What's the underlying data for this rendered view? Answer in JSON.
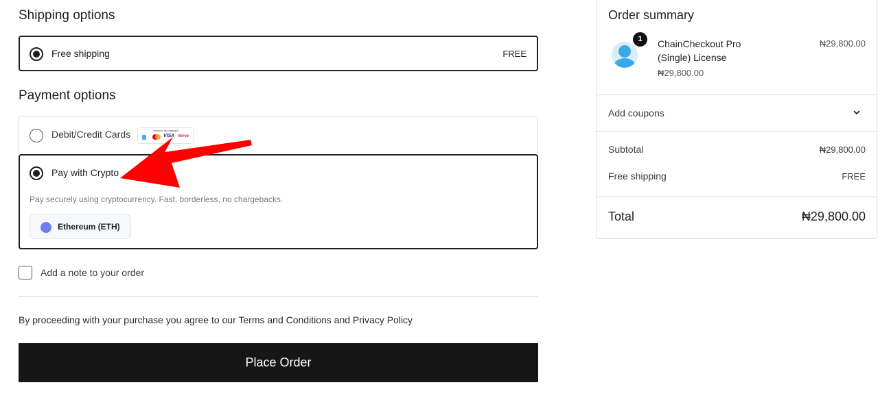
{
  "shipping": {
    "title": "Shipping options",
    "option_label": "Free shipping",
    "option_price": "FREE"
  },
  "payment": {
    "title": "Payment options",
    "card_label": "Debit/Credit Cards",
    "card_logos_caption": "Secured by paystack",
    "card_logo_visa": "VISA",
    "card_logo_verve": "Verve",
    "crypto_label": "Pay with Crypto",
    "crypto_description": "Pay securely using cryptocurrency. Fast, borderless, no chargebacks.",
    "crypto_coin": "Ethereum (ETH)"
  },
  "order_note": {
    "label": "Add a note to your order"
  },
  "terms": {
    "text": "By proceeding with your purchase you agree to our Terms and Conditions and Privacy Policy"
  },
  "place_order": {
    "label": "Place Order"
  },
  "summary": {
    "title": "Order summary",
    "item": {
      "quantity": "1",
      "name": "ChainCheckout Pro (Single) License",
      "unit_price": "₦29,800.00",
      "line_price": "₦29,800.00"
    },
    "coupons_label": "Add coupons",
    "subtotal_label": "Subtotal",
    "subtotal_value": "₦29,800.00",
    "shipping_label": "Free shipping",
    "shipping_value": "FREE",
    "total_label": "Total",
    "total_value": "₦29,800.00"
  },
  "colors": {
    "accent": "#161616",
    "annotation_arrow": "#ff0000",
    "eth": "#6b7ff0"
  }
}
